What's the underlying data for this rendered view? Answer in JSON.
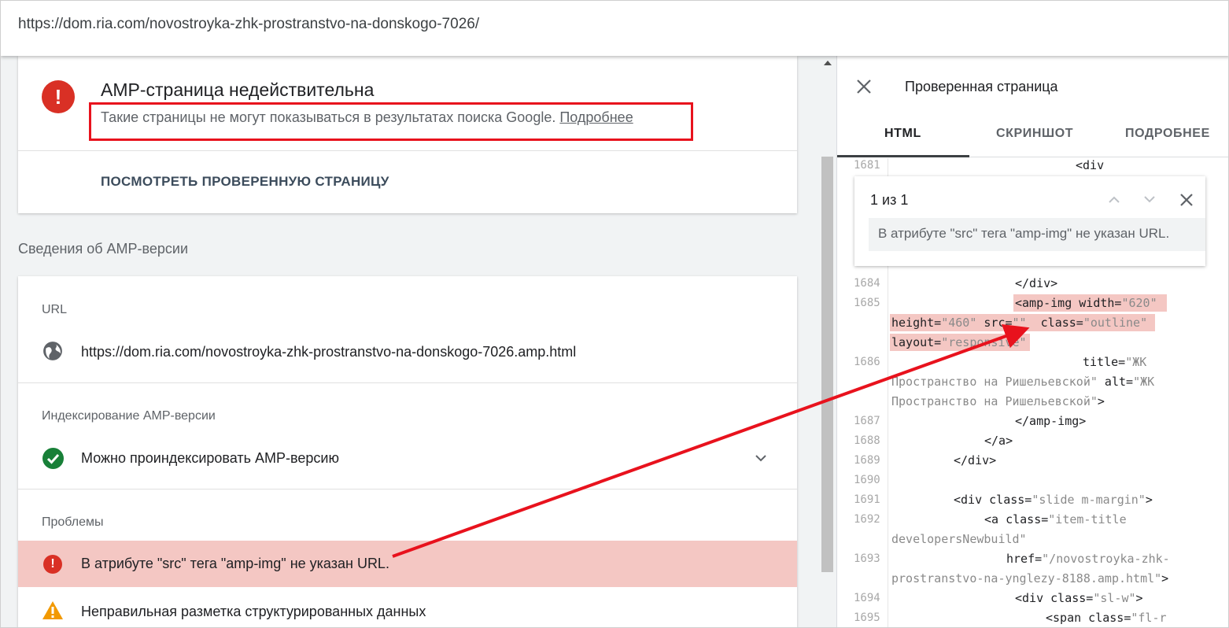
{
  "url_bar": {
    "url": "https://dom.ria.com/novostroyka-zhk-prostranstvo-na-donskogo-7026/"
  },
  "status_card": {
    "title": "AMP-страница недействительна",
    "description": "Такие страницы не могут показываться в результатах поиска Google.",
    "more_link": "Подробнее",
    "view_button": "ПОСМОТРЕТЬ ПРОВЕРЕННУЮ СТРАНИЦУ"
  },
  "amp_section": {
    "heading": "Сведения об AMP-версии",
    "url_label": "URL",
    "amp_url": "https://dom.ria.com/novostroyka-zhk-prostranstvo-na-donskogo-7026.amp.html",
    "indexing_label": "Индексирование AMP-версии",
    "indexing_status": "Можно проиндексировать AMP-версию",
    "problems_label": "Проблемы",
    "problems": [
      "В атрибуте \"src\" тега \"amp-img\" не указан URL.",
      "Неправильная разметка структурированных данных"
    ]
  },
  "panel": {
    "title": "Проверенная страница",
    "tabs": [
      "HTML",
      "СКРИНШОТ",
      "ПОДРОБНЕЕ"
    ],
    "find": {
      "count": "1 из 1",
      "message": "В атрибуте \"src\" тега \"amp-img\" не указан URL."
    },
    "line_numbers": [
      "1681",
      "1684",
      "1685",
      "1686",
      "1687",
      "1688",
      "1689",
      "1690",
      "1691",
      "1692",
      "1693",
      "1694",
      "1695"
    ],
    "code": {
      "l1681": "<div",
      "l1684": "</div>",
      "l1685a": "<amp-img width=",
      "l1685a_v": "\"620\"",
      "l1685b1": "height=",
      "l1685b1_v": "\"460\"",
      "l1685b2": " src=",
      "l1685b2_v": "\"\"",
      "l1685b3": "  class=",
      "l1685b3_v": "\"outline\"",
      "l1685c": "layout=",
      "l1685c_v": "\"responsive\"",
      "l1686a": "title=",
      "l1686a_v": "\"ЖК",
      "l1686b_v": "Пространство на Ришельевской\"",
      "l1686b2": " alt=",
      "l1686b2_v": "\"ЖК",
      "l1686c_v": "Пространство на Ришельевской\"",
      "l1686c2": ">",
      "l1687": "</amp-img>",
      "l1688": "</a>",
      "l1689": "</div>",
      "l1691a": "<div class=",
      "l1691a_v": "\"slide m-margin\"",
      "l1691b": ">",
      "l1692a": "<a class=",
      "l1692a_v": "\"item-title",
      "l1692b_v": "developersNewbuild\"",
      "l1693a": "href=",
      "l1693a_v": "\"/novostroyka-zhk-",
      "l1693b_v": "prostranstvo-na-ynglezy-8188.amp.html\"",
      "l1693b2": ">",
      "l1694a": "<div class=",
      "l1694a_v": "\"sl-w\"",
      "l1694b": ">",
      "l1695a": "<span class=",
      "l1695a_v": "\"fl-r"
    }
  },
  "colors": {
    "error_red": "#d93025",
    "annotation_red": "#e8121d",
    "success_green": "#188038",
    "warning_orange": "#f29900",
    "problem_highlight": "#f4c7c3"
  }
}
